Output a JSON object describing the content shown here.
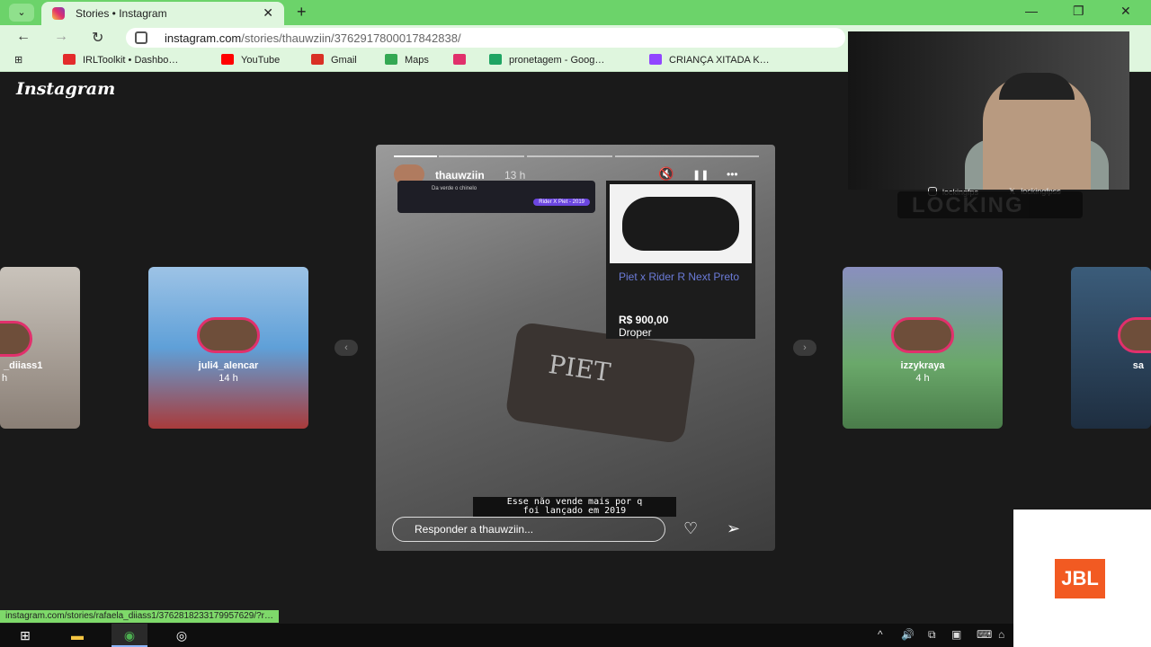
{
  "browser": {
    "tab": {
      "title": "Stories • Instagram",
      "close": "✕"
    },
    "new_tab": "+",
    "tab_dropdown": "⌄",
    "window": {
      "minimize": "—",
      "restore": "❐",
      "close": "✕"
    },
    "nav": {
      "back": "←",
      "forward": "→",
      "reload": "↻"
    },
    "url_host": "instagram.com",
    "url_path": "/stories/thauwziin/3762917800017842838/",
    "bookmarks": [
      {
        "label": "IRLToolkit • Dashbo…",
        "icon": "yandex-icon",
        "color": "#e32b2b"
      },
      {
        "label": "YouTube",
        "icon": "youtube-icon",
        "color": "#ff0000"
      },
      {
        "label": "Gmail",
        "icon": "gmail-icon",
        "color": "#d93025"
      },
      {
        "label": "Maps",
        "icon": "maps-icon",
        "color": "#34a853"
      },
      {
        "label": "",
        "icon": "instagram-icon",
        "color": "#e1306c"
      },
      {
        "label": "pronetagem - Goog…",
        "icon": "drive-icon",
        "color": "#1fa463"
      },
      {
        "label": "CRIANÇA XITADA K…",
        "icon": "twitch-icon",
        "color": "#9146ff"
      }
    ]
  },
  "instagram": {
    "logo": "Instagram",
    "side_stories": [
      {
        "user": "_diiass1",
        "time": "h"
      },
      {
        "user": "juli4_alencar",
        "time": "14 h"
      },
      {
        "user": "izzykraya",
        "time": "4 h"
      },
      {
        "user": "sa",
        "time": ""
      }
    ],
    "prev_arrow": "‹",
    "next_arrow": "›",
    "story": {
      "user": "thauwziin",
      "time": "13 h",
      "mute_icon": "🔇",
      "pause_icon": "❚❚",
      "more_icon": "•••",
      "dm_text": "Da verde o chinelo",
      "dm_badge": "Rider X Piet - 2019",
      "product": {
        "name": "Piet x Rider R Next Preto",
        "price": "R$ 900,00",
        "store": "Droper"
      },
      "bag_text": "PIET",
      "caption_line1": "Esse não vende mais por q",
      "caption_line2": "foi lançado em 2019",
      "reply_placeholder": "Responder a thauwziin...",
      "like_icon": "♡",
      "send_icon": "➢",
      "progress": 0.2
    }
  },
  "overlay": {
    "instagram_handle": "lockingfps",
    "x_handle": "lockingfpss",
    "banner": "LOCKING",
    "sponsor": "JBL"
  },
  "status_url": "instagram.com/stories/rafaela_diiass1/3762818233179957629/?r…",
  "taskbar": {
    "start": "⊞",
    "explorer": "▬",
    "chrome": "◉",
    "obs": "◎",
    "tray": [
      "^",
      "🔊",
      "⧉",
      "▣",
      "⌨",
      "⌂"
    ]
  }
}
